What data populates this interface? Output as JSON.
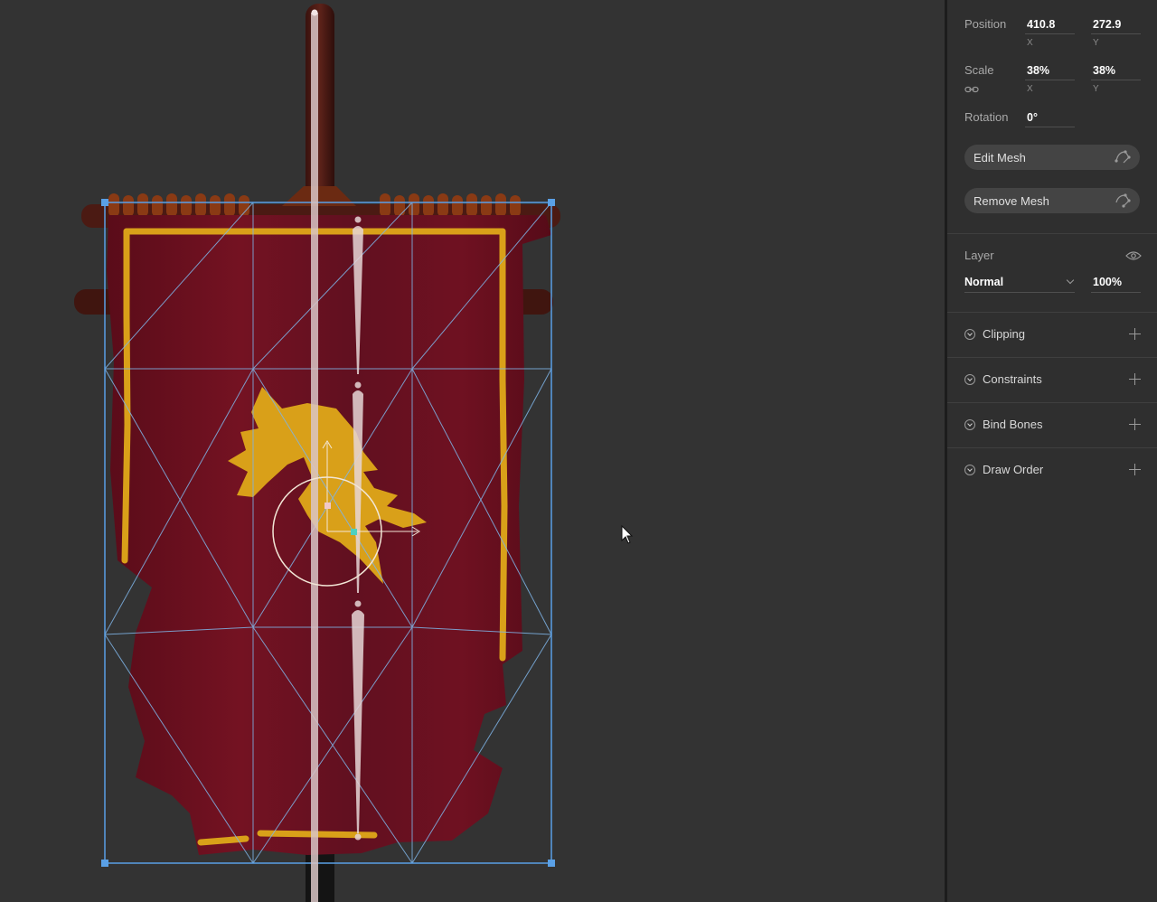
{
  "inspector": {
    "position": {
      "label": "Position",
      "x": "410.8",
      "y": "272.9",
      "x_axis": "X",
      "y_axis": "Y"
    },
    "scale": {
      "label": "Scale",
      "x": "38%",
      "y": "38%",
      "x_axis": "X",
      "y_axis": "Y",
      "link_icon": "link-icon"
    },
    "rotation": {
      "label": "Rotation",
      "value": "0°"
    },
    "buttons": {
      "edit_mesh": "Edit Mesh",
      "remove_mesh": "Remove Mesh",
      "mesh_icon": "mesh-icon"
    },
    "layer": {
      "label": "Layer",
      "visibility_icon": "eye-icon",
      "blend_mode": "Normal",
      "opacity": "100%"
    },
    "sections": [
      {
        "name": "Clipping"
      },
      {
        "name": "Constraints"
      },
      {
        "name": "Bind Bones"
      },
      {
        "name": "Draw Order"
      }
    ]
  },
  "colors": {
    "banner": "#6e0f1e",
    "gold": "#d9a019",
    "pole": "#4a1a14",
    "selection": "#5aa0e6",
    "bone": "#d9c6c6",
    "canvas_bg": "#333333",
    "panel_bg": "#2f2f2f"
  }
}
